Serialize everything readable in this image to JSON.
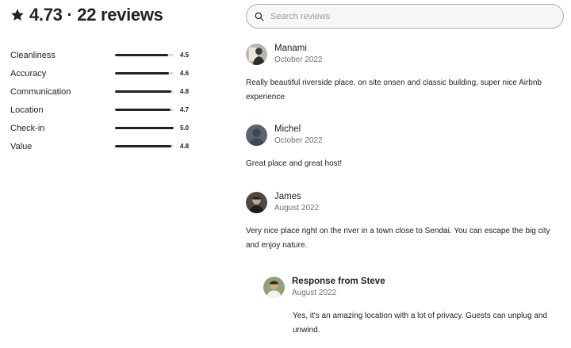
{
  "header": {
    "icon": "star-icon",
    "title": "4.73 · 22 reviews"
  },
  "search": {
    "icon": "search-icon",
    "placeholder": "Search reviews",
    "value": ""
  },
  "ratings": [
    {
      "label": "Cleanliness",
      "value": "4.5",
      "fraction": 0.9
    },
    {
      "label": "Accuracy",
      "value": "4.6",
      "fraction": 0.92
    },
    {
      "label": "Communication",
      "value": "4.8",
      "fraction": 0.96
    },
    {
      "label": "Location",
      "value": "4.7",
      "fraction": 0.94
    },
    {
      "label": "Check-in",
      "value": "5.0",
      "fraction": 1.0
    },
    {
      "label": "Value",
      "value": "4.8",
      "fraction": 0.96
    }
  ],
  "reviews": [
    {
      "name": "Manami",
      "date": "October 2022",
      "text": "Really beautiful riverside place, on site onsen and classic building, super nice Airbnb experience"
    },
    {
      "name": "Michel",
      "date": "October 2022",
      "text": "Great place and great host!"
    },
    {
      "name": "James",
      "date": "August 2022",
      "text": "Very nice place right on the river in a town close to Sendai. You can escape the big city and enjoy nature."
    }
  ],
  "response": {
    "name": "Response from Steve",
    "date": "August 2022",
    "text": "Yes, it's an amazing location with a lot of privacy. Guests can unplug and unwind."
  },
  "colors": {
    "text": "#222222",
    "muted": "#717171",
    "bar_track": "#dddddd",
    "bar_fill": "#222222"
  }
}
